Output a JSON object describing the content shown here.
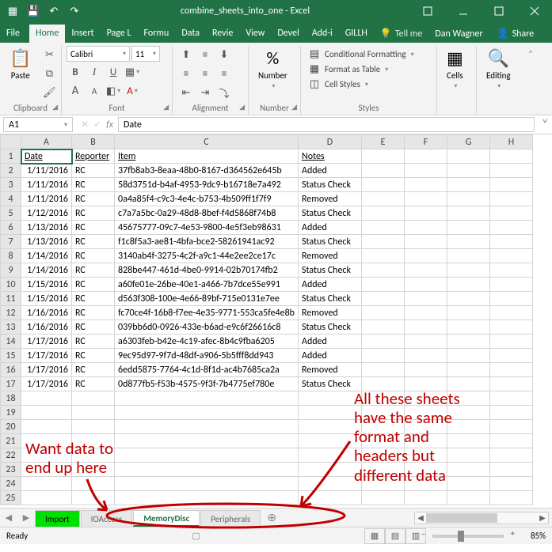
{
  "titlebar": {
    "title": "combine_sheets_into_one - Excel"
  },
  "menutabs": {
    "file": "File",
    "tabs": [
      "Home",
      "Insert",
      "Page L",
      "Formu",
      "Data",
      "Revie",
      "View",
      "Devel",
      "Add-i",
      "GILLH"
    ],
    "active": "Home",
    "tellme": "Tell me",
    "user": "Dan Wagner",
    "share": "Share"
  },
  "ribbon": {
    "clipboard": {
      "label": "Clipboard",
      "paste": "Paste"
    },
    "font": {
      "label": "Font",
      "family": "Calibri",
      "size": "11",
      "bold": "B",
      "italic": "I",
      "under": "U",
      "fontgrow": "A",
      "fontshrink": "A"
    },
    "alignment": {
      "label": "Alignment"
    },
    "number": {
      "label": "Number",
      "btn": "Number",
      "pct": "%"
    },
    "styles": {
      "label": "Styles",
      "condfmt": "Conditional Formatting",
      "table": "Format as Table",
      "cellstyles": "Cell Styles"
    },
    "cells": {
      "label": "Cells"
    },
    "editing": {
      "label": "Editing"
    }
  },
  "formula": {
    "cell": "A1",
    "value": "Date",
    "fx": "fx"
  },
  "columns": [
    "A",
    "B",
    "C",
    "D",
    "E",
    "F",
    "G",
    "H"
  ],
  "headers": {
    "date": "Date",
    "reporter": "Reporter",
    "item": "Item",
    "notes": "Notes"
  },
  "rows": [
    {
      "r": 2,
      "date": "1/11/2016",
      "rep": "RC",
      "item": "37fb8ab3-8eaa-48b0-8167-d364562e645b",
      "notes": "Added"
    },
    {
      "r": 3,
      "date": "1/11/2016",
      "rep": "RC",
      "item": "58d3751d-b4af-4953-9dc9-b16718e7a492",
      "notes": "Status Check"
    },
    {
      "r": 4,
      "date": "1/11/2016",
      "rep": "RC",
      "item": "0a4a85f4-c9c3-4e4c-b753-4b509ff1f7f9",
      "notes": "Removed"
    },
    {
      "r": 5,
      "date": "1/12/2016",
      "rep": "RC",
      "item": "c7a7a5bc-0a29-48d8-8bef-f4d5868f74b8",
      "notes": "Status Check"
    },
    {
      "r": 6,
      "date": "1/13/2016",
      "rep": "RC",
      "item": "45675777-09c7-4e53-9800-4e5f3eb98631",
      "notes": "Added"
    },
    {
      "r": 7,
      "date": "1/13/2016",
      "rep": "RC",
      "item": "f1c8f5a3-ae81-4bfa-bce2-58261941ac92",
      "notes": "Status Check"
    },
    {
      "r": 8,
      "date": "1/14/2016",
      "rep": "RC",
      "item": "3140ab4f-3275-4c2f-a9c1-44e2ee2ce17c",
      "notes": "Removed"
    },
    {
      "r": 9,
      "date": "1/14/2016",
      "rep": "RC",
      "item": "828be447-461d-4be0-9914-02b70174fb2",
      "notes": "Status Check"
    },
    {
      "r": 10,
      "date": "1/15/2016",
      "rep": "RC",
      "item": "a60fe01e-26be-40e1-a466-7b7dce55e991",
      "notes": "Added"
    },
    {
      "r": 11,
      "date": "1/15/2016",
      "rep": "RC",
      "item": "d563f308-100e-4e66-89bf-715e0131e7ee",
      "notes": "Status Check"
    },
    {
      "r": 12,
      "date": "1/16/2016",
      "rep": "RC",
      "item": "fc70ce4f-16b8-f7ee-4e35-9771-553ca5fe4e8b",
      "notes": "Removed"
    },
    {
      "r": 13,
      "date": "1/16/2016",
      "rep": "RC",
      "item": "039bb6d0-0926-433e-b6ad-e9c6f26616c8",
      "notes": "Status Check"
    },
    {
      "r": 14,
      "date": "1/17/2016",
      "rep": "RC",
      "item": "a6303feb-b42e-4c19-afec-8b4c9fba6205",
      "notes": "Added"
    },
    {
      "r": 15,
      "date": "1/17/2016",
      "rep": "RC",
      "item": "9ec95d97-9f7d-48df-a906-5b5fff8dd943",
      "notes": "Added"
    },
    {
      "r": 16,
      "date": "1/17/2016",
      "rep": "RC",
      "item": "6edd5875-7764-4c1d-8f1d-ac4b7685ca2a",
      "notes": "Removed"
    },
    {
      "r": 17,
      "date": "1/17/2016",
      "rep": "RC",
      "item": "0d877fb5-f53b-4575-9f3f-7b4775ef780e",
      "notes": "Status Check"
    }
  ],
  "blankrows": [
    18,
    19,
    20,
    21,
    22,
    23,
    24,
    25
  ],
  "sheettabs": {
    "tabs": [
      {
        "name": "Import",
        "kind": "import"
      },
      {
        "name": "IOAccess",
        "kind": "inactive"
      },
      {
        "name": "MemoryDisc",
        "kind": "active"
      },
      {
        "name": "Peripherals",
        "kind": "inactive"
      }
    ]
  },
  "status": {
    "ready": "Ready",
    "zoom": "85%"
  },
  "annotations": {
    "a1": "Want data to\nend up here",
    "a2": "All these sheets\nhave the same\nformat and\nheaders but\ndifferent data"
  }
}
